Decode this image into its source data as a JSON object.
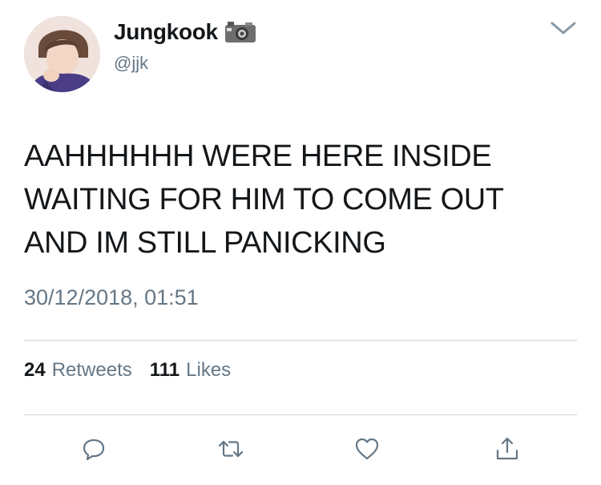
{
  "user": {
    "display_name": "Jungkook",
    "handle": "@jjk",
    "badge_emoji": "camera-with-flash"
  },
  "tweet": {
    "lines": [
      "AAHHHHHH WERE HERE INSIDE",
      "WAITING FOR HIM TO COME OUT",
      "AND IM STILL PANICKING"
    ],
    "timestamp": "30/12/2018, 01:51"
  },
  "stats": {
    "retweets_count": "24",
    "retweets_label": "Retweets",
    "likes_count": "111",
    "likes_label": "Likes"
  },
  "actions": [
    "reply-icon",
    "retweet-icon",
    "like-icon",
    "share-icon"
  ],
  "colors": {
    "text": "#14171a",
    "secondary": "#657786",
    "divider": "#cfd6dc"
  }
}
